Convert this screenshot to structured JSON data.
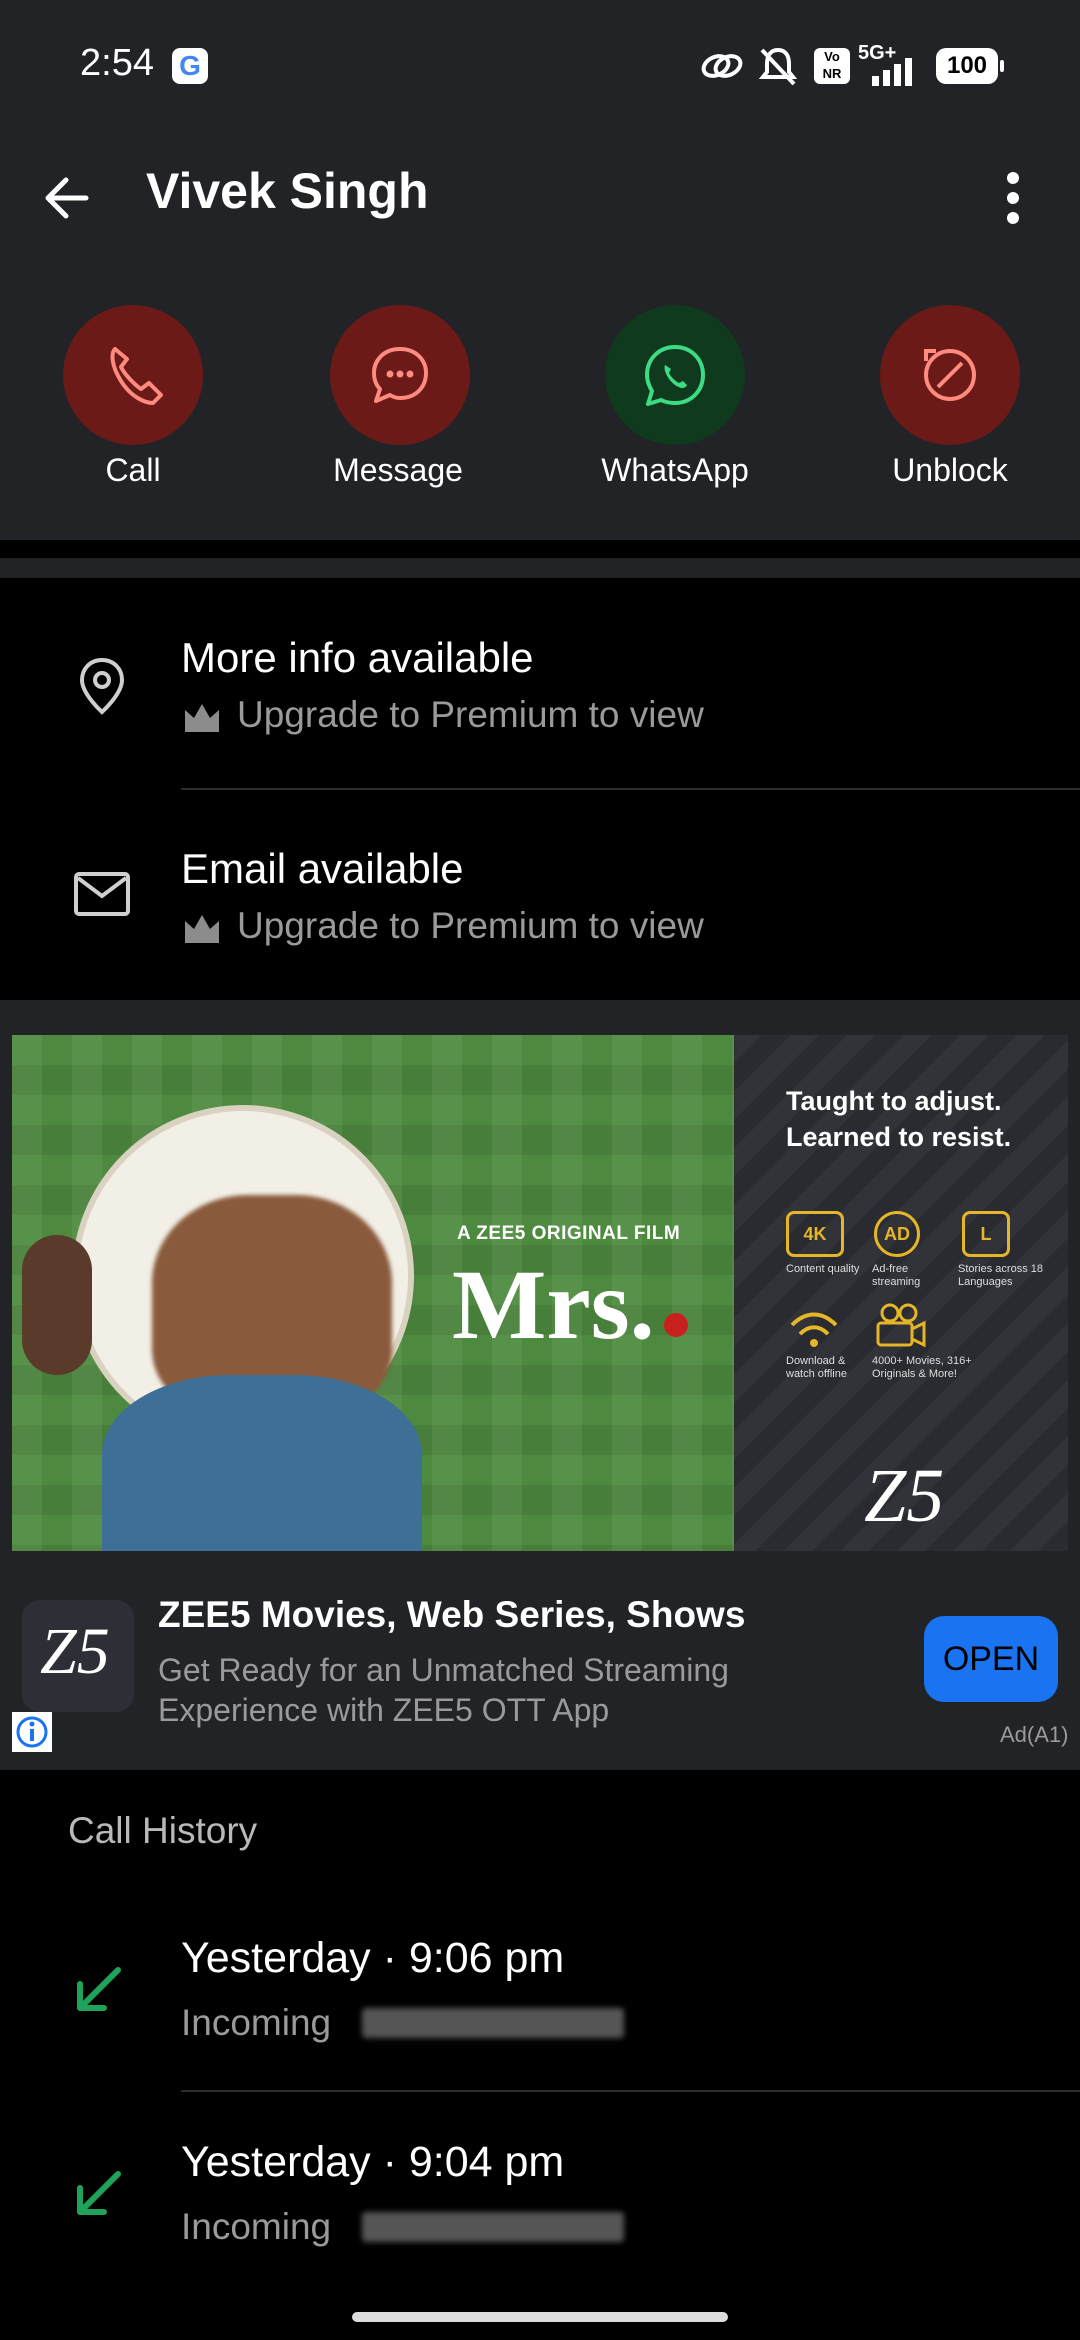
{
  "status_bar": {
    "time": "2:54",
    "network": "5G+",
    "battery": "100"
  },
  "header": {
    "title": "Vivek Singh"
  },
  "actions": [
    {
      "label": "Call",
      "icon": "phone-icon",
      "color": "#6b1a17"
    },
    {
      "label": "Message",
      "icon": "chat-bubble-icon",
      "color": "#6b1a17"
    },
    {
      "label": "WhatsApp",
      "icon": "whatsapp-icon",
      "color": "#0f3a1e"
    },
    {
      "label": "Unblock",
      "icon": "unblock-icon",
      "color": "#6b1a17"
    }
  ],
  "info": [
    {
      "title": "More info available",
      "subtitle": "Upgrade to Premium to view",
      "icon": "location-pin-icon"
    },
    {
      "title": "Email available",
      "subtitle": "Upgrade to Premium to view",
      "icon": "mail-icon"
    }
  ],
  "ad": {
    "kicker": "A ZEE5 ORIGINAL FILM",
    "film_title": "Mrs.",
    "tagline_1": "Taught to adjust.",
    "tagline_2": "Learned to resist.",
    "features": [
      {
        "icon_text": "4K",
        "label": "Content quality"
      },
      {
        "icon_text": "AD",
        "label": "Ad-free streaming"
      },
      {
        "icon_text": "L",
        "label": "Stories across 18 Languages"
      },
      {
        "icon_text": "",
        "label": "Download & watch offline"
      },
      {
        "icon_text": "",
        "label": "4000+ Movies, 316+ Originals & More!"
      }
    ],
    "brand_logo": "Z5",
    "app_title": "ZEE5 Movies, Web Series, Shows",
    "app_desc_1": "Get Ready for an Unmatched Streaming",
    "app_desc_2": "Experience with ZEE5 OTT App",
    "cta": "OPEN",
    "ad_label": "Ad(A1)",
    "cta_color": "#1a73f0"
  },
  "call_history": {
    "title": "Call History",
    "entries": [
      {
        "time": "Yesterday · 9:06 pm",
        "type": "Incoming"
      },
      {
        "time": "Yesterday · 9:04 pm",
        "type": "Incoming"
      }
    ]
  }
}
